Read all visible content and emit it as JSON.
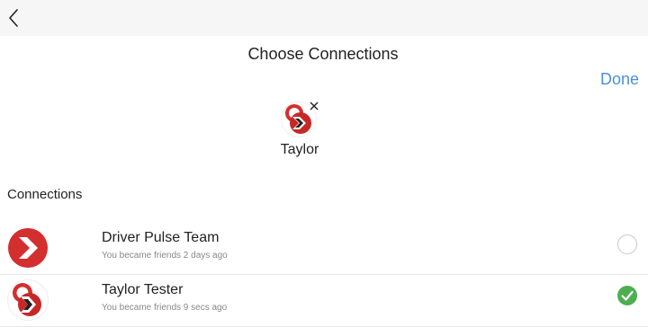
{
  "header": {
    "title": "Choose Connections",
    "done_label": "Done"
  },
  "selected": {
    "name": "Taylor",
    "avatar_icon": "driver-pulse-logo-icon",
    "remove_icon": "close-icon"
  },
  "connections": {
    "section_label": "Connections",
    "items": [
      {
        "name": "Driver Pulse Team",
        "subtitle": "You became friends 2 days ago",
        "avatar_icon": "red-chevron-logo-icon",
        "selected": false
      },
      {
        "name": "Taylor Tester",
        "subtitle": "You became friends 9 secs ago",
        "avatar_icon": "driver-pulse-logo-icon",
        "selected": true
      }
    ]
  },
  "colors": {
    "accent": "#4a90d9",
    "check_green": "#4caf50",
    "brand_red": "#d32f2f"
  }
}
